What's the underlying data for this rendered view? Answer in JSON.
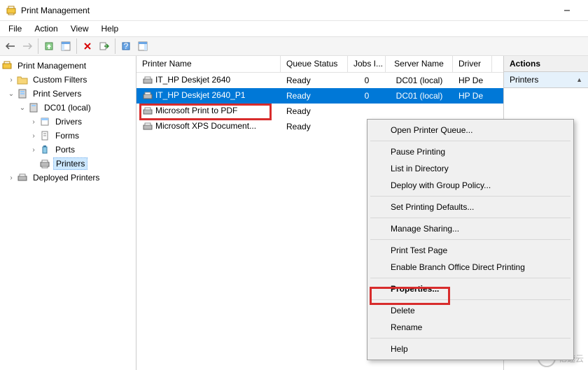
{
  "window": {
    "title": "Print Management"
  },
  "menubar": {
    "file": "File",
    "action": "Action",
    "view": "View",
    "help": "Help"
  },
  "tree": {
    "root": "Print Management",
    "custom_filters": "Custom Filters",
    "print_servers": "Print Servers",
    "server": "DC01 (local)",
    "drivers": "Drivers",
    "forms": "Forms",
    "ports": "Ports",
    "printers": "Printers",
    "deployed": "Deployed Printers"
  },
  "columns": {
    "name": "Printer Name",
    "queue": "Queue Status",
    "jobs": "Jobs I...",
    "server": "Server Name",
    "driver": "Driver"
  },
  "printers": [
    {
      "name": "IT_HP Deskjet 2640",
      "queue": "Ready",
      "jobs": "0",
      "server": "DC01 (local)",
      "driver": "HP De"
    },
    {
      "name": "IT_HP Deskjet 2640_P1",
      "queue": "Ready",
      "jobs": "0",
      "server": "DC01 (local)",
      "driver": "HP De"
    },
    {
      "name": "Microsoft Print to PDF",
      "queue": "Ready",
      "jobs": "",
      "server": "",
      "driver": ""
    },
    {
      "name": "Microsoft XPS Document...",
      "queue": "Ready",
      "jobs": "",
      "server": "",
      "driver": ""
    }
  ],
  "actions": {
    "header": "Actions",
    "printers": "Printers"
  },
  "context_menu": {
    "open_queue": "Open Printer Queue...",
    "pause": "Pause Printing",
    "list_dir": "List in Directory",
    "deploy_gp": "Deploy with Group Policy...",
    "defaults": "Set Printing Defaults...",
    "sharing": "Manage Sharing...",
    "test_page": "Print Test Page",
    "branch": "Enable Branch Office Direct Printing",
    "properties": "Properties...",
    "delete": "Delete",
    "rename": "Rename",
    "help": "Help"
  },
  "watermark": "亿速云"
}
